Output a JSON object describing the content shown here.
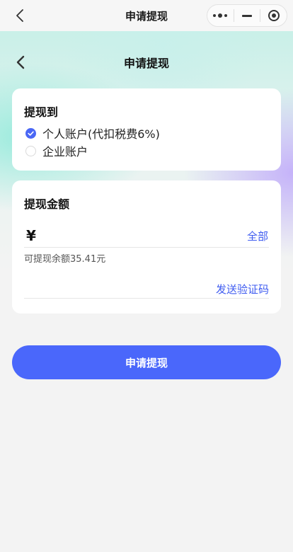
{
  "miniprogram_bar": {
    "title": "申请提现",
    "back_icon": "chevron-left-icon",
    "capsule_icons": [
      "more-dots-icon",
      "minimize-icon",
      "close-target-icon"
    ]
  },
  "header": {
    "title": "申请提现",
    "back_icon": "chevron-left-icon"
  },
  "withdraw_to": {
    "title": "提现到",
    "options": [
      {
        "label": "个人账户(代扣税费6%)",
        "selected": true
      },
      {
        "label": "企业账户",
        "selected": false
      }
    ]
  },
  "amount": {
    "title": "提现金额",
    "currency_symbol": "¥",
    "value": "",
    "placeholder": "",
    "all_label": "全部",
    "balance_text": "可提现余额35.41元",
    "code_value": "",
    "code_placeholder": "",
    "send_code_label": "发送验证码"
  },
  "submit": {
    "label": "申请提现"
  },
  "colors": {
    "accent": "#4a67fb",
    "link": "#3e5bf0",
    "background": "#f3f3f3"
  }
}
